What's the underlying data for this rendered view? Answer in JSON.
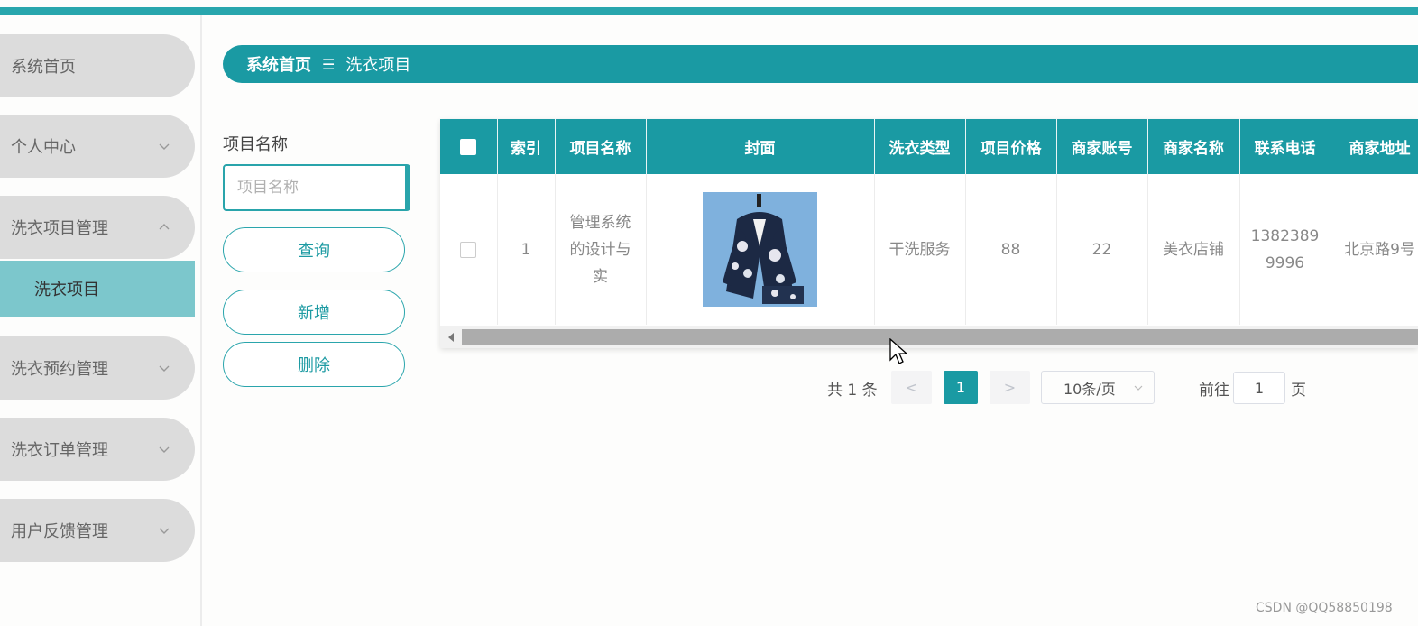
{
  "sidebar": {
    "items": [
      {
        "label": "系统首页",
        "chevron": "none"
      },
      {
        "label": "个人中心",
        "chevron": "down"
      },
      {
        "label": "洗衣项目管理",
        "chevron": "up"
      },
      {
        "label": "洗衣预约管理",
        "chevron": "down"
      },
      {
        "label": "洗衣订单管理",
        "chevron": "down"
      },
      {
        "label": "用户反馈管理",
        "chevron": "down"
      }
    ],
    "active_sub": "洗衣项目"
  },
  "breadcrumb": {
    "home": "系统首页",
    "separator": "☰",
    "current": "洗衣项目"
  },
  "search": {
    "label": "项目名称",
    "placeholder": "项目名称",
    "value": ""
  },
  "buttons": {
    "query": "查询",
    "add": "新增",
    "delete": "删除"
  },
  "table": {
    "columns": [
      "索引",
      "项目名称",
      "封面",
      "洗衣类型",
      "项目价格",
      "商家账号",
      "商家名称",
      "联系电话",
      "商家地址"
    ],
    "rows": [
      {
        "index": "1",
        "name": "管理系统的设计与实",
        "cover": "suit-image",
        "type": "干洗服务",
        "price": "88",
        "account": "22",
        "merchant": "美衣店铺",
        "phone": "13823899996",
        "address": "北京路9号"
      }
    ]
  },
  "pagination": {
    "total": "共 1 条",
    "prev": "<",
    "current_page": "1",
    "next": ">",
    "page_size": "10条/页",
    "goto_label": "前往",
    "goto_value": "1",
    "page_suffix": "页"
  },
  "watermark": "CSDN @QQ58850198",
  "colors": {
    "accent": "#1a9aa3",
    "topbar": "#28a6ad",
    "sidebar_item": "#dcdcdc",
    "sidebar_active": "#7cc7cc"
  }
}
